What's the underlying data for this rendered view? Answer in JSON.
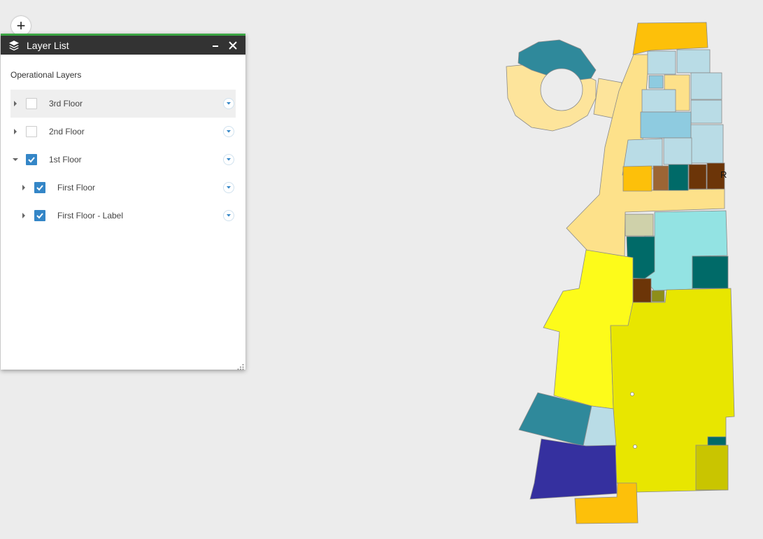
{
  "map": {
    "zoom_in_label": "+",
    "labels": [
      "R"
    ]
  },
  "layer_list": {
    "title": "Layer List",
    "icon": "layers-icon",
    "accent_color": "#3ba443",
    "section_label": "Operational Layers",
    "layers": [
      {
        "label": "3rd Floor",
        "checked": false,
        "expanded": false,
        "level": 0
      },
      {
        "label": "2nd Floor",
        "checked": false,
        "expanded": false,
        "level": 0
      },
      {
        "label": "1st Floor",
        "checked": true,
        "expanded": true,
        "level": 0
      },
      {
        "label": "First Floor",
        "checked": true,
        "expanded": false,
        "level": 1
      },
      {
        "label": "First Floor - Label",
        "checked": true,
        "expanded": false,
        "level": 1
      }
    ]
  }
}
